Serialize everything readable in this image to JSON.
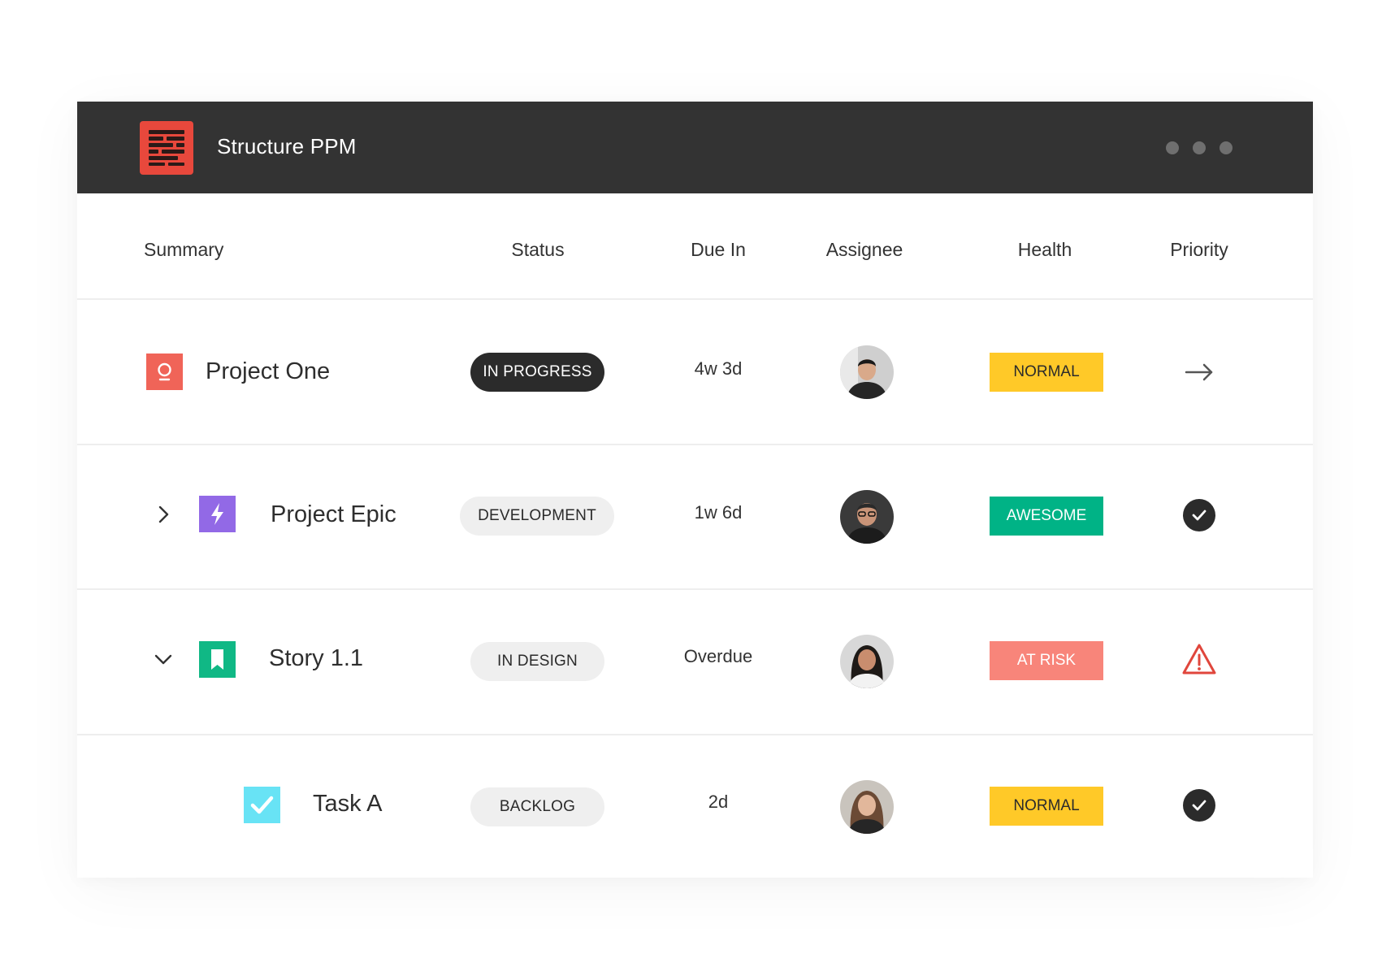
{
  "app": {
    "title": "Structure PPM",
    "logo_icon": "structure-logo-icon"
  },
  "colors": {
    "titlebar": "#333333",
    "logo": "#e8483c",
    "normal": "#ffc928",
    "awesome": "#00b386",
    "at_risk": "#f8857a",
    "dark_pill": "#2b2b2b",
    "light_pill": "#efefef"
  },
  "columns": {
    "summary": "Summary",
    "status": "Status",
    "due_in": "Due In",
    "assignee": "Assignee",
    "health": "Health",
    "priority": "Priority"
  },
  "rows": [
    {
      "type_icon": "idea-icon",
      "summary": "Project One",
      "status": "IN PROGRESS",
      "due_in": "4w 3d",
      "assignee_avatar": "avatar-man-1",
      "health": "NORMAL",
      "priority_icon": "arrow-right-icon"
    },
    {
      "expander": "chevron-right-icon",
      "type_icon": "lightning-icon",
      "summary": "Project Epic",
      "status": "DEVELOPMENT",
      "due_in": "1w 6d",
      "assignee_avatar": "avatar-man-2",
      "health": "AWESOME",
      "priority_icon": "check-circle-icon"
    },
    {
      "expander": "chevron-down-icon",
      "type_icon": "bookmark-icon",
      "summary": "Story 1.1",
      "status": "IN DESIGN",
      "due_in": "Overdue",
      "assignee_avatar": "avatar-woman-1",
      "health": "AT RISK",
      "priority_icon": "warning-triangle-icon"
    },
    {
      "type_icon": "checkbox-icon",
      "summary": "Task A",
      "status": "BACKLOG",
      "due_in": "2d",
      "assignee_avatar": "avatar-woman-2",
      "health": "NORMAL",
      "priority_icon": "check-circle-icon"
    }
  ]
}
